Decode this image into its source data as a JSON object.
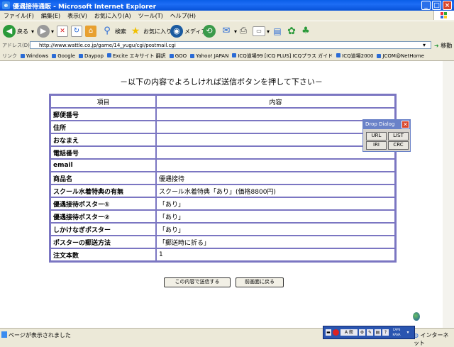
{
  "window": {
    "title": "優遇接待通販 - Microsoft Internet Explorer",
    "controls": [
      "_",
      "□",
      "×"
    ]
  },
  "menu": [
    "ファイル(F)",
    "編集(E)",
    "表示(V)",
    "お気に入り(A)",
    "ツール(T)",
    "ヘルプ(H)"
  ],
  "toolbar": {
    "back": "戻る",
    "search": "検索",
    "favorites": "お気に入り",
    "media": "メディア"
  },
  "address": {
    "label": "アドレス(D)",
    "url": "http://www.wattle.co.jp/game/14_yugu/cgi/postmail.cgi",
    "go": "移動"
  },
  "links": {
    "label": "リンク",
    "items": [
      "Windows",
      "Google",
      "Daypop",
      "Excite エキサイト 翻訳",
      "GOO",
      "Yahoo! JAPAN",
      "ICQ道場99 [ICQ PLUS] ICQプラス ガイド",
      "ICQ道場2000",
      "JCOM@NetHome"
    ]
  },
  "page": {
    "heading": "－以下の内容でよろしければ送信ボタンを押して下さい－",
    "table_headers": [
      "項目",
      "内容"
    ],
    "rows": [
      {
        "label": "郵便番号",
        "value": ""
      },
      {
        "label": "住所",
        "value": ""
      },
      {
        "label": "おなまえ",
        "value": ""
      },
      {
        "label": "電話番号",
        "value": ""
      },
      {
        "label": "email",
        "value": ""
      },
      {
        "label": "商品名",
        "value": "優遇接待"
      },
      {
        "label": "スクール水着特典の有無",
        "value": "スクール水着特典「あり」(価格8800円)"
      },
      {
        "label": "優遇接待ポスター①",
        "value": "「あり」"
      },
      {
        "label": "優遇接待ポスター②",
        "value": "「あり」"
      },
      {
        "label": "しかけなぎポスター",
        "value": "「あり」"
      },
      {
        "label": "ポスターの郵送方法",
        "value": "「郵送時に折る」"
      },
      {
        "label": "注文本数",
        "value": "1"
      }
    ],
    "submit_button": "この内容で送信する",
    "back_button": "前画面に戻る"
  },
  "drop_dialog": {
    "title": "Drop Dialog",
    "buttons": [
      "URL",
      "LIST",
      "IRI",
      "CRC"
    ]
  },
  "status": {
    "text": "ページが表示されました",
    "zone": "インターネット"
  },
  "ime": {
    "mode": "A 般",
    "caps": "CAPS",
    "kana": "KANA"
  },
  "colors": {
    "title_blue": "#0a5ee8",
    "table_border": "#7b76c2",
    "dialog_title": "#6a82c8"
  }
}
